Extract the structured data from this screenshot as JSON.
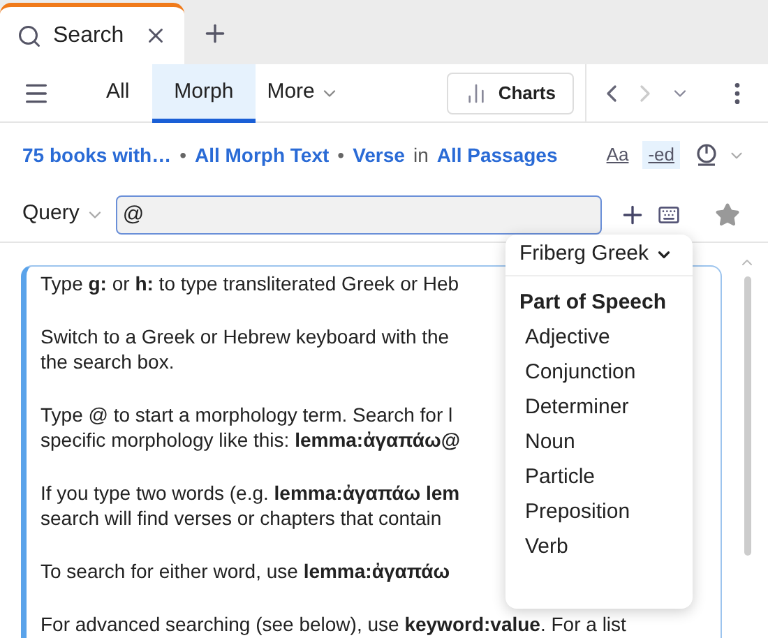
{
  "tabs": [
    {
      "label": "Search",
      "selected": true
    }
  ],
  "search_tabs": [
    {
      "label": "All",
      "selected": false
    },
    {
      "label": "Morph",
      "selected": true
    }
  ],
  "more_menu": "More",
  "charts_button": "Charts",
  "scope": {
    "books": "75 books with…",
    "text": "All Morph Text",
    "unit": "Verse",
    "connector": "in",
    "separators": [
      "•",
      "•"
    ],
    "range": "All Passages"
  },
  "toggles": [
    {
      "label": "Aa",
      "selected": false
    },
    {
      "label": "-ed",
      "selected": true
    }
  ],
  "query": {
    "label": "Query",
    "value": "@"
  },
  "help": [
    {
      "lines": [
        "Type **g:** or **h:** to type transliterated Greek or Heb"
      ]
    },
    {
      "lines": [
        "Switch to a Greek or Hebrew keyboard with the",
        "the search box."
      ]
    },
    {
      "lines": [
        "Type @ to start a morphology term. Search for l",
        "specific morphology like this: **lemma:ἀγαπάω@**"
      ]
    },
    {
      "lines": [
        "If you type two words (e.g. **lemma:ἀγαπάω lem**",
        "search will find verses or chapters that contain"
      ]
    },
    {
      "lines": [
        "To search for either word, use **lemma:ἀγαπάω**"
      ]
    },
    {
      "lines": [
        "For advanced searching (see below), use **keyword:value**. For a list"
      ]
    }
  ],
  "popup": {
    "source": "Friberg Greek",
    "heading": "Part of Speech",
    "items": [
      "Adjective",
      "Conjunction",
      "Determiner",
      "Noun",
      "Particle",
      "Preposition",
      "Verb"
    ]
  }
}
